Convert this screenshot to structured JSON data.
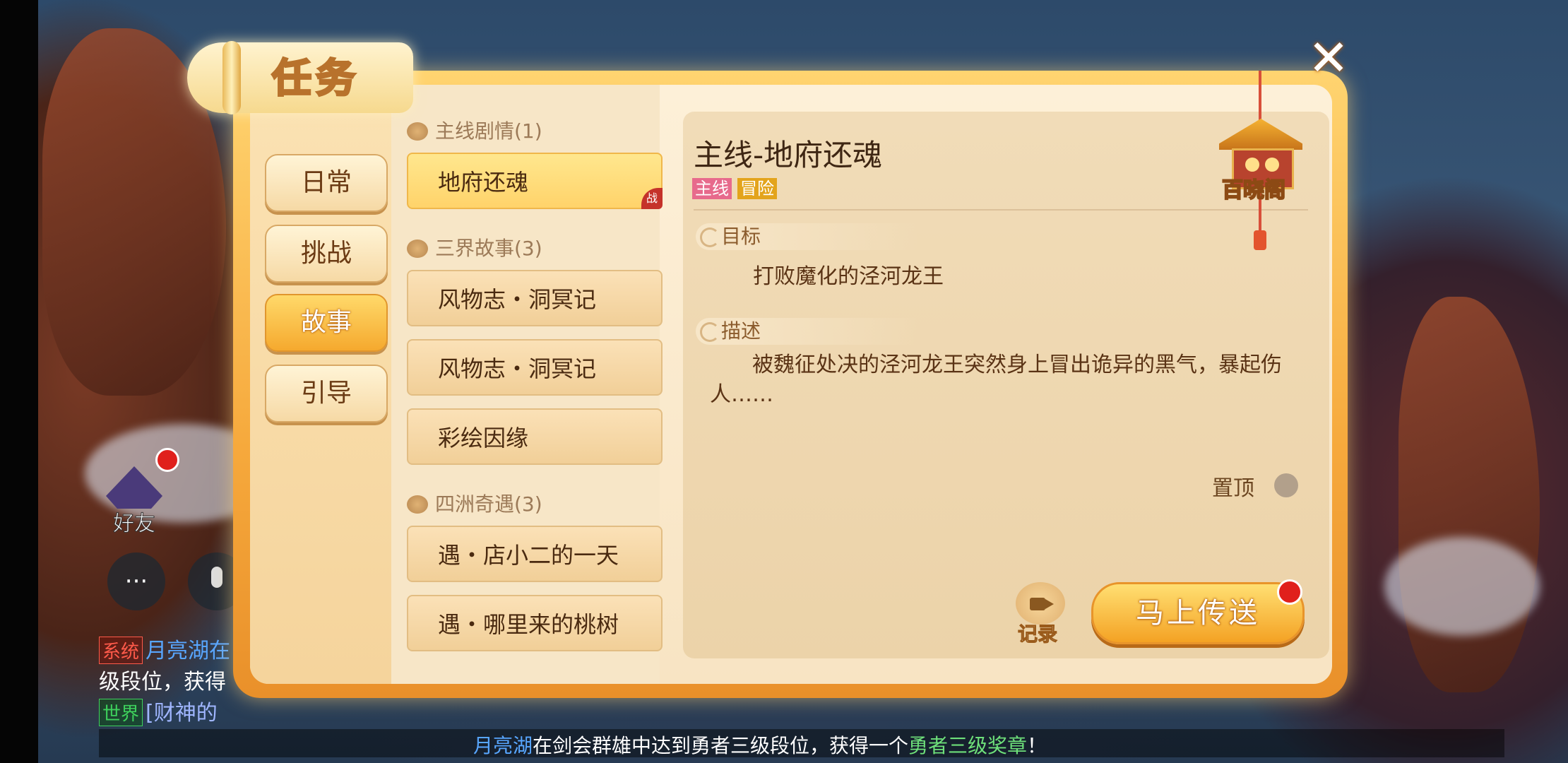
{
  "header": {
    "title": "任务",
    "close_label": "✕"
  },
  "tabs": [
    {
      "label": "日常",
      "active": false
    },
    {
      "label": "挑战",
      "active": false
    },
    {
      "label": "故事",
      "active": true
    },
    {
      "label": "引导",
      "active": false
    }
  ],
  "quest_groups": [
    {
      "title": "主线剧情(1)",
      "items": [
        {
          "label": "地府还魂",
          "active": true,
          "badge": "战"
        }
      ]
    },
    {
      "title": "三界故事(3)",
      "items": [
        {
          "label": "风物志・洞冥记"
        },
        {
          "label": "风物志・洞冥记"
        },
        {
          "label": "彩绘因缘"
        }
      ]
    },
    {
      "title": "四洲奇遇(3)",
      "items": [
        {
          "label": "遇・店小二的一天"
        },
        {
          "label": "遇・哪里来的桃树"
        }
      ]
    }
  ],
  "detail": {
    "title": "主线-地府还魂",
    "tags": [
      "主线",
      "冒险"
    ],
    "goal_heading": "目标",
    "goal_text": "打败魔化的泾河龙王",
    "desc_heading": "描述",
    "desc_text": "被魏征处决的泾河龙王突然身上冒出诡异的黑气，暴起伤人……",
    "pin_label": "置顶",
    "pavilion_label": "百晓阁",
    "record_label": "记录",
    "teleport_label": "马上传送"
  },
  "hud": {
    "friend_label": "好友",
    "chat": [
      {
        "channel": "系统",
        "text": "月亮湖在"
      },
      {
        "channel": "",
        "text": "级段位，获得"
      },
      {
        "channel": "世界",
        "text": "[财神的"
      }
    ],
    "broadcast": {
      "name": "月亮湖",
      "pre": "在剑会群雄中达到勇者三级段位，获得一个",
      "medal": "勇者三级奖章",
      "post": "！"
    }
  },
  "colors": {
    "accent": "#f5a92e",
    "panel": "#fdf0d8",
    "text": "#4a2a10",
    "alert": "#e0201c"
  }
}
